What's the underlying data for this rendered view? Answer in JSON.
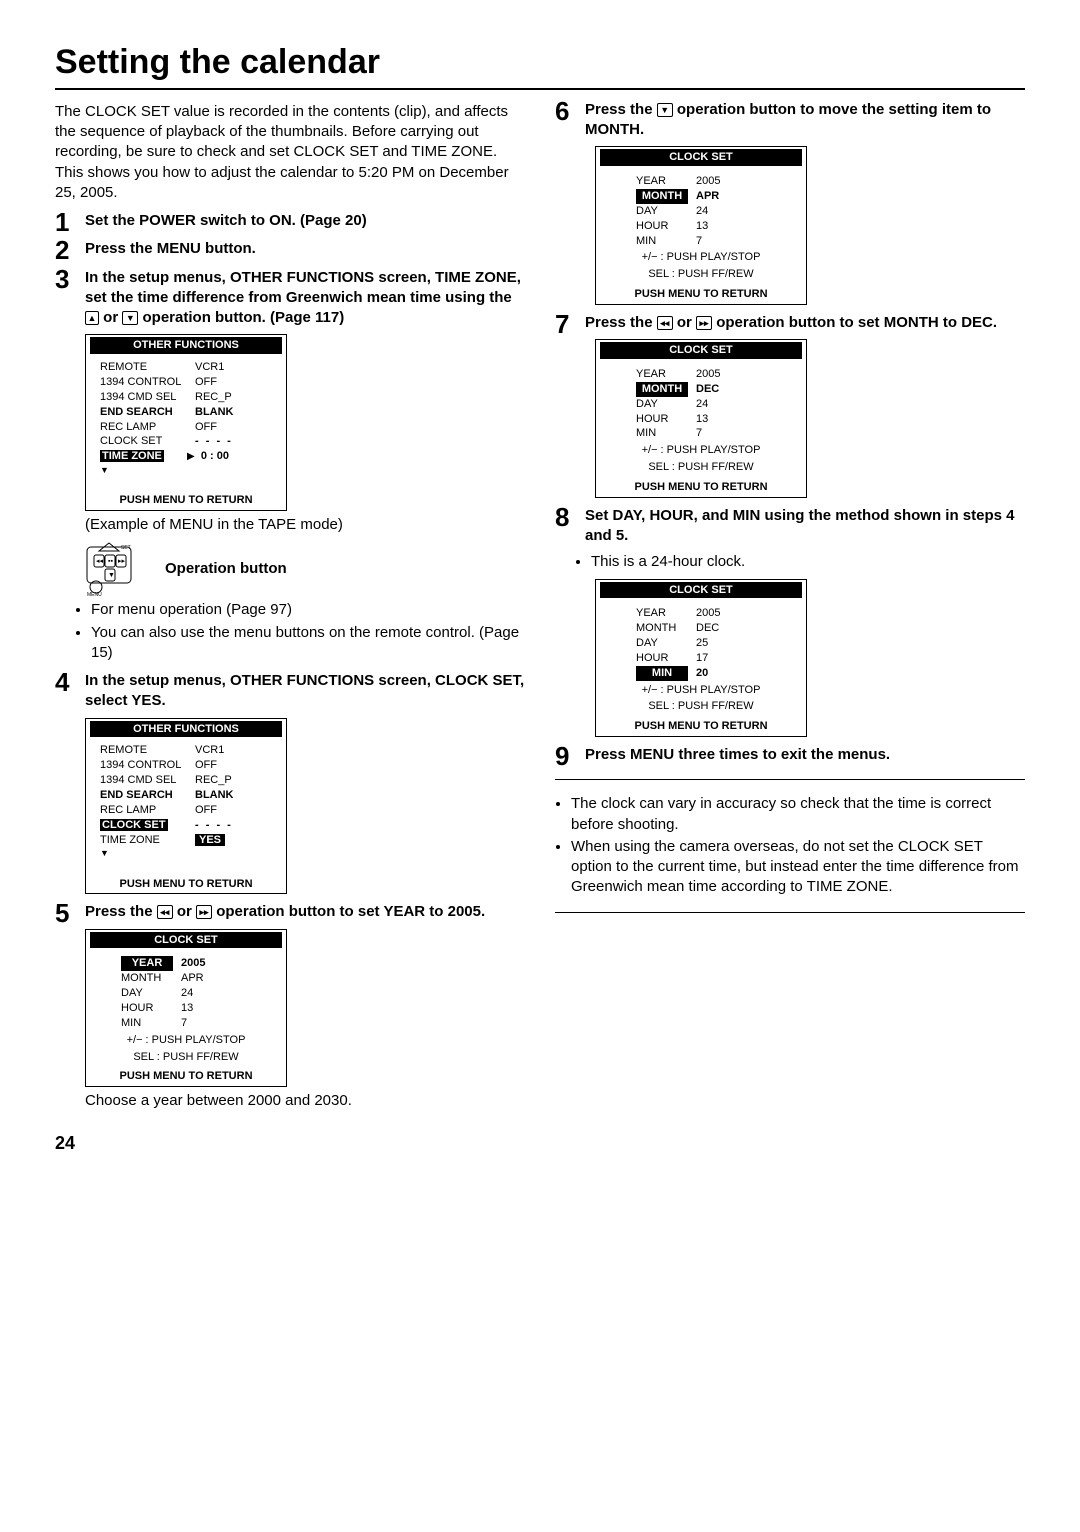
{
  "title": "Setting the calendar",
  "intro": "The CLOCK SET value is recorded in the contents (clip), and affects the sequence of playback of the thumbnails. Before carrying out recording, be sure to check and set CLOCK SET and TIME ZONE. This shows you how to adjust the calendar to 5:20 PM on December 25, 2005.",
  "page_number": "24",
  "s1_txt": "Set the POWER switch to ON. (Page 20)",
  "s2_txt": "Press the MENU button.",
  "s3_txt_a": "In the setup menus, OTHER FUNCTIONS screen, TIME ZONE, set the time difference from Greenwich mean time using the ",
  "s3_txt_b": " or ",
  "s3_txt_c": " operation button. (Page 117)",
  "s3_caption": "(Example of MENU in the TAPE mode)",
  "op_btn_label": "Operation button",
  "s3_bullet1": "For menu operation (Page 97)",
  "s3_bullet2": "You can also use the menu buttons on the remote control. (Page 15)",
  "s4_txt": "In the setup menus, OTHER FUNCTIONS screen, CLOCK SET, select YES.",
  "s5_txt_a": "Press the ",
  "s5_txt_b": " or ",
  "s5_txt_c": " operation button to set YEAR to 2005.",
  "s5_note": "Choose a year between 2000 and 2030.",
  "s6_txt_a": "Press the ",
  "s6_txt_b": " operation button to move the setting item to MONTH.",
  "s7_txt_a": "Press the ",
  "s7_txt_b": " or ",
  "s7_txt_c": " operation button to set MONTH to DEC.",
  "s8_txt": "Set DAY, HOUR, and MIN using the method shown in steps 4 and 5.",
  "s8_bullet": "This is a 24-hour clock.",
  "s9_txt": "Press MENU three times to exit the menus.",
  "end_b1": "The clock can vary in accuracy so check that the time is correct before shooting.",
  "end_b2": "When using the camera overseas, do not set the CLOCK SET option to the current time, but instead enter the time difference from Greenwich mean time according to TIME ZONE.",
  "of_title": "OTHER  FUNCTIONS",
  "of_r1k": "REMOTE",
  "of_r1v": "VCR1",
  "of_r2k": "1394  CONTROL",
  "of_r2v": "OFF",
  "of_r3k": "1394  CMD SEL",
  "of_r3v": "REC_P",
  "of_r4k": "END SEARCH",
  "of_r4v": "BLANK",
  "of_r5k": "REC LAMP",
  "of_r5v": "OFF",
  "of_r6k": "CLOCK SET",
  "of_r6v": "- - - -",
  "of_r7k": "TIME ZONE",
  "of_r7v": "0 : 00",
  "of_r7arrow": "▶",
  "of_yes": "YES",
  "of_footer": "PUSH  MENU  TO  RETURN",
  "cs_title": "CLOCK  SET",
  "cs_year_k": "YEAR",
  "cs_month_k": "MONTH",
  "cs_day_k": "DAY",
  "cs_hour_k": "HOUR",
  "cs_min_k": "MIN",
  "cs_h1": "+/−  : PUSH  PLAY/STOP",
  "cs_h2": "SEL : PUSH  FF/REW",
  "cs_footer": "PUSH  MENU  TO  RETURN",
  "cs5_year": "2005",
  "cs5_month": "APR",
  "cs5_day": "24",
  "cs5_hour": "13",
  "cs5_min": "7",
  "cs6_year": "2005",
  "cs6_month": "APR",
  "cs6_day": "24",
  "cs6_hour": "13",
  "cs6_min": "7",
  "cs7_year": "2005",
  "cs7_month": "DEC",
  "cs7_day": "24",
  "cs7_hour": "13",
  "cs7_min": "7",
  "cs8_year": "2005",
  "cs8_month": "DEC",
  "cs8_day": "25",
  "cs8_hour": "17",
  "cs8_min": "20",
  "icon_set_label": "SET",
  "icon_menu_label": "MENU"
}
